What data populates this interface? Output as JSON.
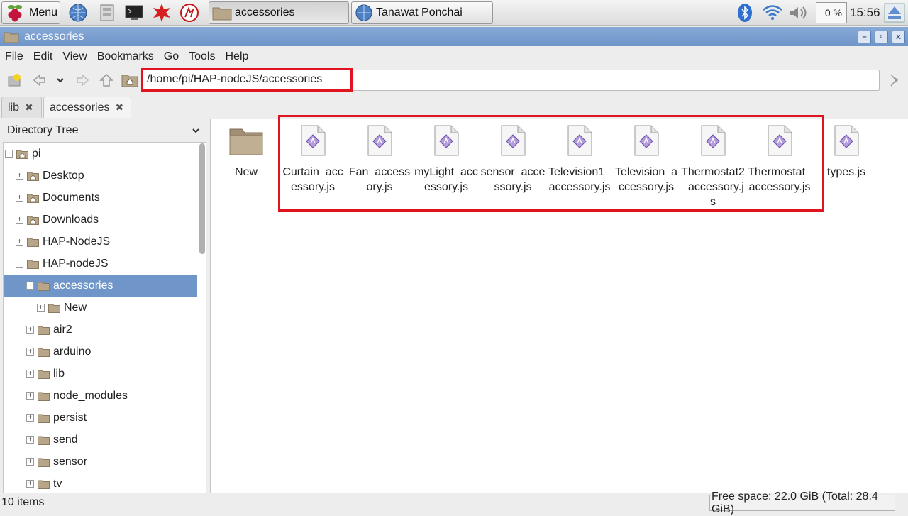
{
  "taskbar": {
    "menu_label": "Menu",
    "window_buttons": [
      {
        "label": "accessories"
      },
      {
        "label": "Tanawat Ponchai"
      }
    ],
    "cpu_label": "0 %",
    "clock": "15:56"
  },
  "window": {
    "title": "accessories"
  },
  "menubar": [
    "File",
    "Edit",
    "View",
    "Bookmarks",
    "Go",
    "Tools",
    "Help"
  ],
  "toolbar": {
    "path": "/home/pi/HAP-nodeJS/accessories"
  },
  "tabs": [
    {
      "label": "lib",
      "close": "✖"
    },
    {
      "label": "accessories",
      "close": "✖"
    }
  ],
  "sidebar": {
    "header": "Directory Tree",
    "items": [
      {
        "label": "pi",
        "expander": "−"
      },
      {
        "label": "Desktop",
        "expander": "+"
      },
      {
        "label": "Documents",
        "expander": "+"
      },
      {
        "label": "Downloads",
        "expander": "+"
      },
      {
        "label": "HAP-NodeJS",
        "expander": "+"
      },
      {
        "label": "HAP-nodeJS",
        "expander": "−"
      },
      {
        "label": "accessories",
        "expander": "−"
      },
      {
        "label": "New",
        "expander": "+"
      },
      {
        "label": "air2",
        "expander": "+"
      },
      {
        "label": "arduino",
        "expander": "+"
      },
      {
        "label": "lib",
        "expander": "+"
      },
      {
        "label": "node_modules",
        "expander": "+"
      },
      {
        "label": "persist",
        "expander": "+"
      },
      {
        "label": "send",
        "expander": "+"
      },
      {
        "label": "sensor",
        "expander": "+"
      },
      {
        "label": "tv",
        "expander": "+"
      }
    ]
  },
  "files": [
    {
      "name": "New",
      "type": "folder"
    },
    {
      "name": "Curtain_accessory.js",
      "type": "js"
    },
    {
      "name": "Fan_accessory.js",
      "type": "js"
    },
    {
      "name": "myLight_accessory.js",
      "type": "js"
    },
    {
      "name": "sensor_accessory.js",
      "type": "js"
    },
    {
      "name": "Television1_accessory.js",
      "type": "js"
    },
    {
      "name": "Television_accessory.js",
      "type": "js"
    },
    {
      "name": "Thermostat2_accessory.js",
      "type": "js"
    },
    {
      "name": "Thermostat_accessory.js",
      "type": "js"
    },
    {
      "name": "types.js",
      "type": "js"
    }
  ],
  "status": {
    "items": "10 items",
    "free_space": "Free space: 22.0 GiB (Total: 28.4 GiB)"
  },
  "colors": {
    "selection": "#6f95c9",
    "highlight_box": "#e0141e",
    "folder": "#b7a68a"
  }
}
